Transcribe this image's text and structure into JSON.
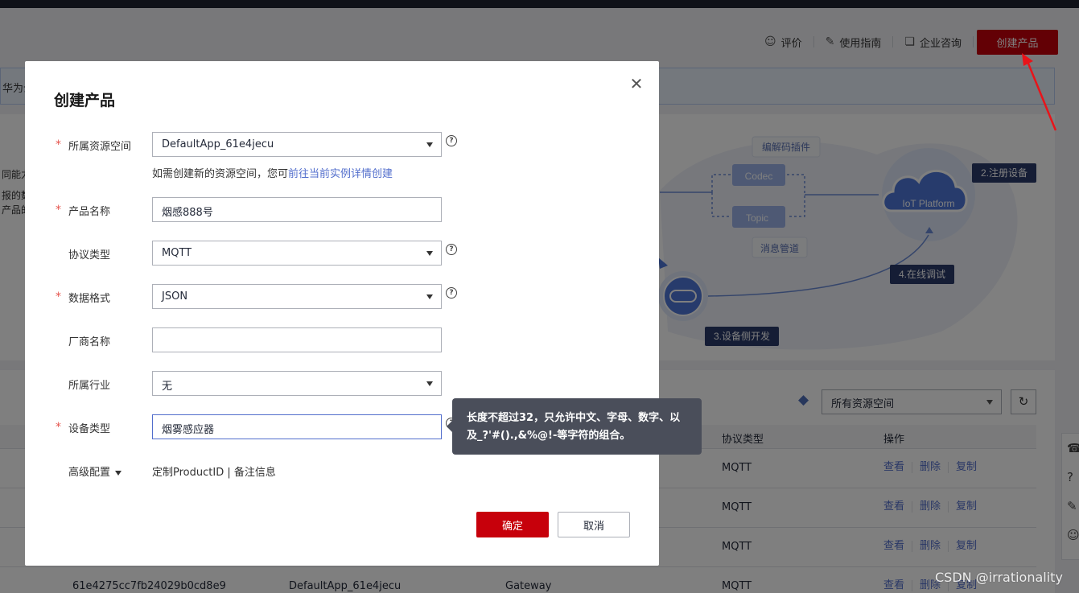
{
  "header": {
    "rate_label": "评价",
    "guide_label": "使用指南",
    "consult_label": "企业咨询",
    "create_product_label": "创建产品"
  },
  "notice": {
    "text": "华为云"
  },
  "intro": {
    "line1": "同能力",
    "line2": "报的数",
    "line3": "产品的"
  },
  "flow": {
    "codec_plugin": "编解码插件",
    "codec": "Codec",
    "topic": "Topic",
    "message_pipe": "消息管道",
    "iot_platform": "IoT Platform",
    "step2": "2.注册设备",
    "step3": "3.设备侧开发",
    "step4": "4.在线调试"
  },
  "list": {
    "workspace_select": "所有资源空间",
    "headers": {
      "protocol": "协议类型",
      "ops": "操作"
    },
    "rows": [
      {
        "id": "",
        "space": "",
        "type": "",
        "protocol": "MQTT"
      },
      {
        "id": "",
        "space": "",
        "type": "",
        "protocol": "MQTT"
      },
      {
        "id": "",
        "space": "",
        "type": "",
        "protocol": "MQTT"
      },
      {
        "id": "61e4275cc7fb24029b0cd8e9",
        "space": "DefaultApp_61e4jecu",
        "type": "Gateway",
        "protocol": "MQTT"
      }
    ],
    "op_view": "查看",
    "op_delete": "删除",
    "op_copy": "复制"
  },
  "watermark": "CSDN @irrationality",
  "dialog": {
    "title": "创建产品",
    "fields": {
      "workspace": {
        "label": "所属资源空间",
        "value": "DefaultApp_61e4jecu",
        "required": true
      },
      "product_name": {
        "label": "产品名称",
        "value": "烟感888号",
        "required": true
      },
      "protocol": {
        "label": "协议类型",
        "value": "MQTT",
        "required": false
      },
      "data_format": {
        "label": "数据格式",
        "value": "JSON",
        "required": true
      },
      "vendor": {
        "label": "厂商名称",
        "value": "",
        "required": false
      },
      "industry": {
        "label": "所属行业",
        "value": "无",
        "required": false
      },
      "device_type": {
        "label": "设备类型",
        "value": "烟雾感应器",
        "required": true
      }
    },
    "hint_prefix": "如需创建新的资源空间，您可",
    "hint_link": "前往当前实例详情创建",
    "advanced_label": "高级配置",
    "advanced_links": "定制ProductID | 备注信息",
    "ok_label": "确定",
    "cancel_label": "取消",
    "required_mark": "*",
    "help_mark": "?"
  },
  "tooltip": {
    "line1": "长度不超过32，只允许中文、字母、数字、以",
    "line2": "及_?'#().,&%@!-等字符的组合。"
  },
  "colors": {
    "brand_red": "#c7000b",
    "link_blue": "#526ecc",
    "tooltip_bg": "#4a4e5a"
  }
}
